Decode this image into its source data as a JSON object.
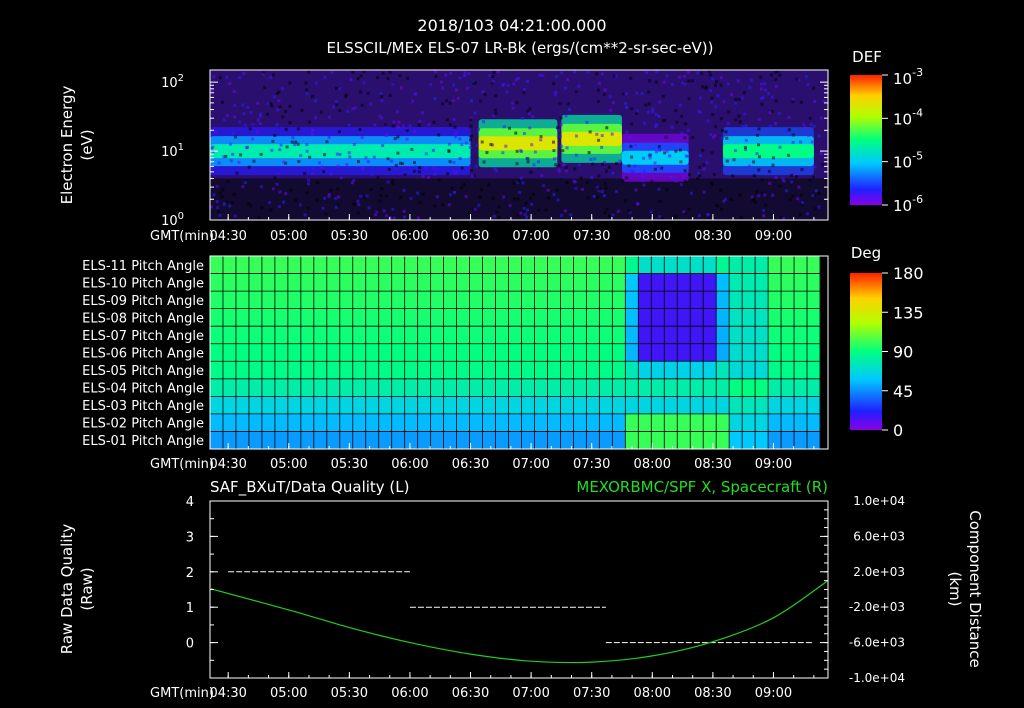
{
  "header": {
    "timestamp": "2018/103 04:21:00.000",
    "subtitle": "ELSSCIL/MEx ELS-07 LR-Bk  (ergs/(cm**2-sr-sec-eV))"
  },
  "time_axis": {
    "label": "GMT(min)",
    "ticks": [
      "04:30",
      "05:00",
      "05:30",
      "06:00",
      "06:30",
      "07:00",
      "07:30",
      "08:00",
      "08:30",
      "09:00"
    ]
  },
  "colors": {
    "background": "#000000",
    "foreground": "#ffffff",
    "quality_line": "#ffffff",
    "spacecraft_line": "#22cc22",
    "right_title": "#22dd22"
  },
  "chart_data": [
    {
      "type": "heatmap",
      "title": "",
      "ylabel": "Electron Energy (eV)",
      "ylabel_lines": [
        "Electron Energy",
        "(eV)"
      ],
      "yscale": "log",
      "ylim": [
        1,
        150
      ],
      "y_ticks": [
        {
          "base": "10",
          "exp": "0",
          "value": 1
        },
        {
          "base": "10",
          "exp": "1",
          "value": 10
        },
        {
          "base": "10",
          "exp": "2",
          "value": 100
        }
      ],
      "xlabel": "GMT(min)",
      "x_range": [
        "04:21",
        "09:27"
      ],
      "colorbar": {
        "label": "DEF",
        "scale": "log",
        "ticks": [
          {
            "base": "10",
            "exp": "-3",
            "value": 0.001
          },
          {
            "base": "10",
            "exp": "-4",
            "value": 0.0001
          },
          {
            "base": "10",
            "exp": "-5",
            "value": 1e-05
          },
          {
            "base": "10",
            "exp": "-6",
            "value": 1e-06
          }
        ]
      },
      "features": [
        {
          "from": "04:21",
          "to": "06:30",
          "energy_eV": 10,
          "level": 2e-05
        },
        {
          "from": "06:34",
          "to": "07:13",
          "energy_eV": 13,
          "level": 0.0002
        },
        {
          "from": "07:15",
          "to": "07:45",
          "energy_eV": 15,
          "level": 0.0002
        },
        {
          "from": "07:45",
          "to": "08:18",
          "energy_eV": 8,
          "level": 1e-05
        },
        {
          "from": "08:35",
          "to": "09:20",
          "energy_eV": 10,
          "level": 3e-05
        }
      ]
    },
    {
      "type": "heatmap",
      "title": "",
      "rows": [
        "ELS-11 Pitch Angle",
        "ELS-10 Pitch Angle",
        "ELS-09 Pitch Angle",
        "ELS-08 Pitch Angle",
        "ELS-07 Pitch Angle",
        "ELS-06 Pitch Angle",
        "ELS-05 Pitch Angle",
        "ELS-04 Pitch Angle",
        "ELS-03 Pitch Angle",
        "ELS-02 Pitch Angle",
        "ELS-01 Pitch Angle"
      ],
      "xlabel": "GMT(min)",
      "x_range": [
        "04:21",
        "09:27"
      ],
      "row_values_deg_before_0745": [
        100,
        98,
        96,
        94,
        92,
        90,
        88,
        80,
        65,
        55,
        48
      ],
      "disturbance": {
        "from": "07:45",
        "to": "08:40",
        "center_deg": 15
      },
      "colorbar": {
        "label": "Deg",
        "min": 0,
        "max": 180,
        "ticks": [
          180,
          135,
          90,
          45,
          0
        ]
      }
    },
    {
      "type": "line",
      "title": "SAF_BXuT/Data Quality (L)",
      "right_title": "MEXORBMC/SPF X, Spacecraft (R)",
      "xlabel": "GMT(min)",
      "ylabel_lines": [
        "Raw Data Quality",
        "(Raw)"
      ],
      "ylim": [
        -1,
        4
      ],
      "y_ticks": [
        4,
        3,
        2,
        1,
        0
      ],
      "y2label_lines": [
        "Component Distance",
        "(km)"
      ],
      "y2lim": [
        -10000,
        10000
      ],
      "y2_ticks": [
        "1.0e+04",
        "6.0e+03",
        "2.0e+03",
        "-2.0e+03",
        "-6.0e+03",
        "-1.0e+04"
      ],
      "series": [
        {
          "name": "SAF_BXuT/Data Quality",
          "axis": "left",
          "style": "dashed",
          "segments": [
            {
              "from": "04:30",
              "to": "06:00",
              "value": 2
            },
            {
              "from": "06:00",
              "to": "07:37",
              "value": 1
            },
            {
              "from": "07:37",
              "to": "09:20",
              "value": 0
            }
          ]
        },
        {
          "name": "MEXORBMC/SPF X, Spacecraft",
          "axis": "right",
          "style": "solid",
          "points": [
            {
              "t": "04:21",
              "km": 100
            },
            {
              "t": "05:00",
              "km": -2300
            },
            {
              "t": "05:30",
              "km": -4300
            },
            {
              "t": "06:00",
              "km": -6000
            },
            {
              "t": "06:30",
              "km": -7300
            },
            {
              "t": "07:00",
              "km": -8100
            },
            {
              "t": "07:30",
              "km": -8200
            },
            {
              "t": "08:00",
              "km": -7500
            },
            {
              "t": "08:30",
              "km": -5900
            },
            {
              "t": "09:00",
              "km": -3200
            },
            {
              "t": "09:27",
              "km": 1000
            }
          ]
        }
      ]
    }
  ]
}
